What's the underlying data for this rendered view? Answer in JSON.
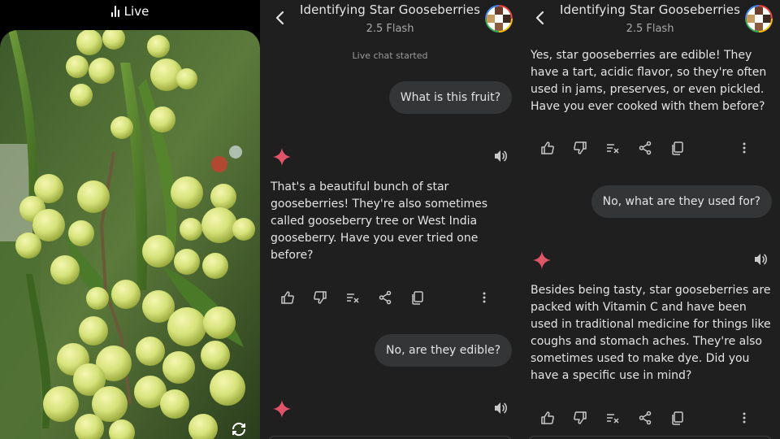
{
  "camera": {
    "live_label": "Live",
    "live_icon": "waveform-icon",
    "flip_icon": "flip-camera-icon"
  },
  "chat": {
    "title": "Identifying Star Gooseberries",
    "model": "2.5 Flash",
    "system_note": "Live chat started",
    "messages": [
      {
        "role": "user",
        "text": "What is this fruit?"
      },
      {
        "role": "model",
        "text": "That's a beautiful bunch of star gooseberries! They're also sometimes called gooseberry tree or West India gooseberry. Have you ever tried one before?"
      },
      {
        "role": "user",
        "text": "No, are they edible?"
      },
      {
        "role": "model",
        "text": "Yes, star gooseberries are edible! They have a tart, acidic flavor, so they're often used in jams, preserves, or even pickled. Have you ever cooked with them before?"
      },
      {
        "role": "user",
        "text": "No, what are they used for?"
      },
      {
        "role": "model",
        "text": "Besides being tasty, star gooseberries are packed with Vitamin C and have been used in traditional medicine for things like coughs and stomach aches. They're also sometimes used to make dye. Did you have a specific use in mind?"
      }
    ]
  },
  "colors": {
    "background": "#1f1f1f",
    "bubble": "#333537",
    "text": "#e3e3e3",
    "muted": "#a8a8a8",
    "sparkle": "#e0546a"
  },
  "icons": [
    "back-arrow-icon",
    "sparkle-icon",
    "speaker-icon",
    "thumbs-up-icon",
    "thumbs-down-icon",
    "modify-response-icon",
    "share-icon",
    "copy-icon",
    "more-vert-icon"
  ]
}
